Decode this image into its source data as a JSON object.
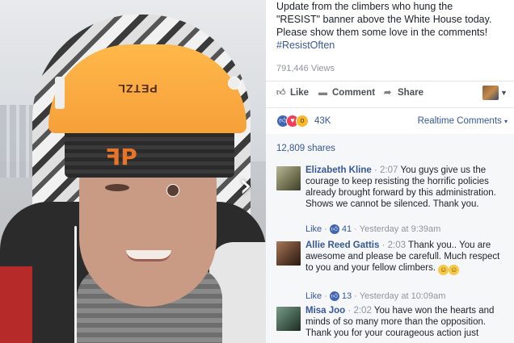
{
  "post": {
    "text_line1": "Update from the climbers who hung the",
    "text_line2": "\"RESIST\" banner above the White House today.",
    "text_line3": "Please show them some love in the comments!",
    "hashtag": "#ResistOften",
    "views": "791,446 Views"
  },
  "video": {
    "helmet_brand": "PETZL",
    "next_icon": "chevron-right-icon"
  },
  "actions": {
    "like": "Like",
    "comment": "Comment",
    "share": "Share"
  },
  "reactions": {
    "count": "43K",
    "sort_label": "Realtime Comments",
    "types": [
      "like",
      "love",
      "wow"
    ]
  },
  "shares": "12,809 shares",
  "comments": [
    {
      "name": "Elizabeth Kline",
      "time": "2:07",
      "text": "You guys give us the courage to keep resisting the horrific policies already brought forward by this administration. Shows we cannot be silenced. Thank you.",
      "like_label": "Like",
      "likes": "41",
      "timestamp": "Yesterday at 9:39am",
      "avatar_color": "#8a8a6a"
    },
    {
      "name": "Allie Reed Gattis",
      "time": "2:03",
      "text": "Thank you.. You are awesome and please be carefull. Much respect to you and your fellow climbers.",
      "like_label": "Like",
      "likes": "13",
      "timestamp": "Yesterday at 10:09am",
      "avatar_color": "#6b4a3a"
    },
    {
      "name": "Misa Joo",
      "time": "2:02",
      "text": "You have won the hearts and minds of so many more than the opposition. Thank you for your courageous action just",
      "avatar_color": "#3f5a4a"
    }
  ],
  "colors": {
    "link": "#365899",
    "like_blue": "#4267b2",
    "love_red": "#f33e58",
    "wow_yellow": "#f7b928",
    "helmet_orange": "#f6a03a"
  }
}
